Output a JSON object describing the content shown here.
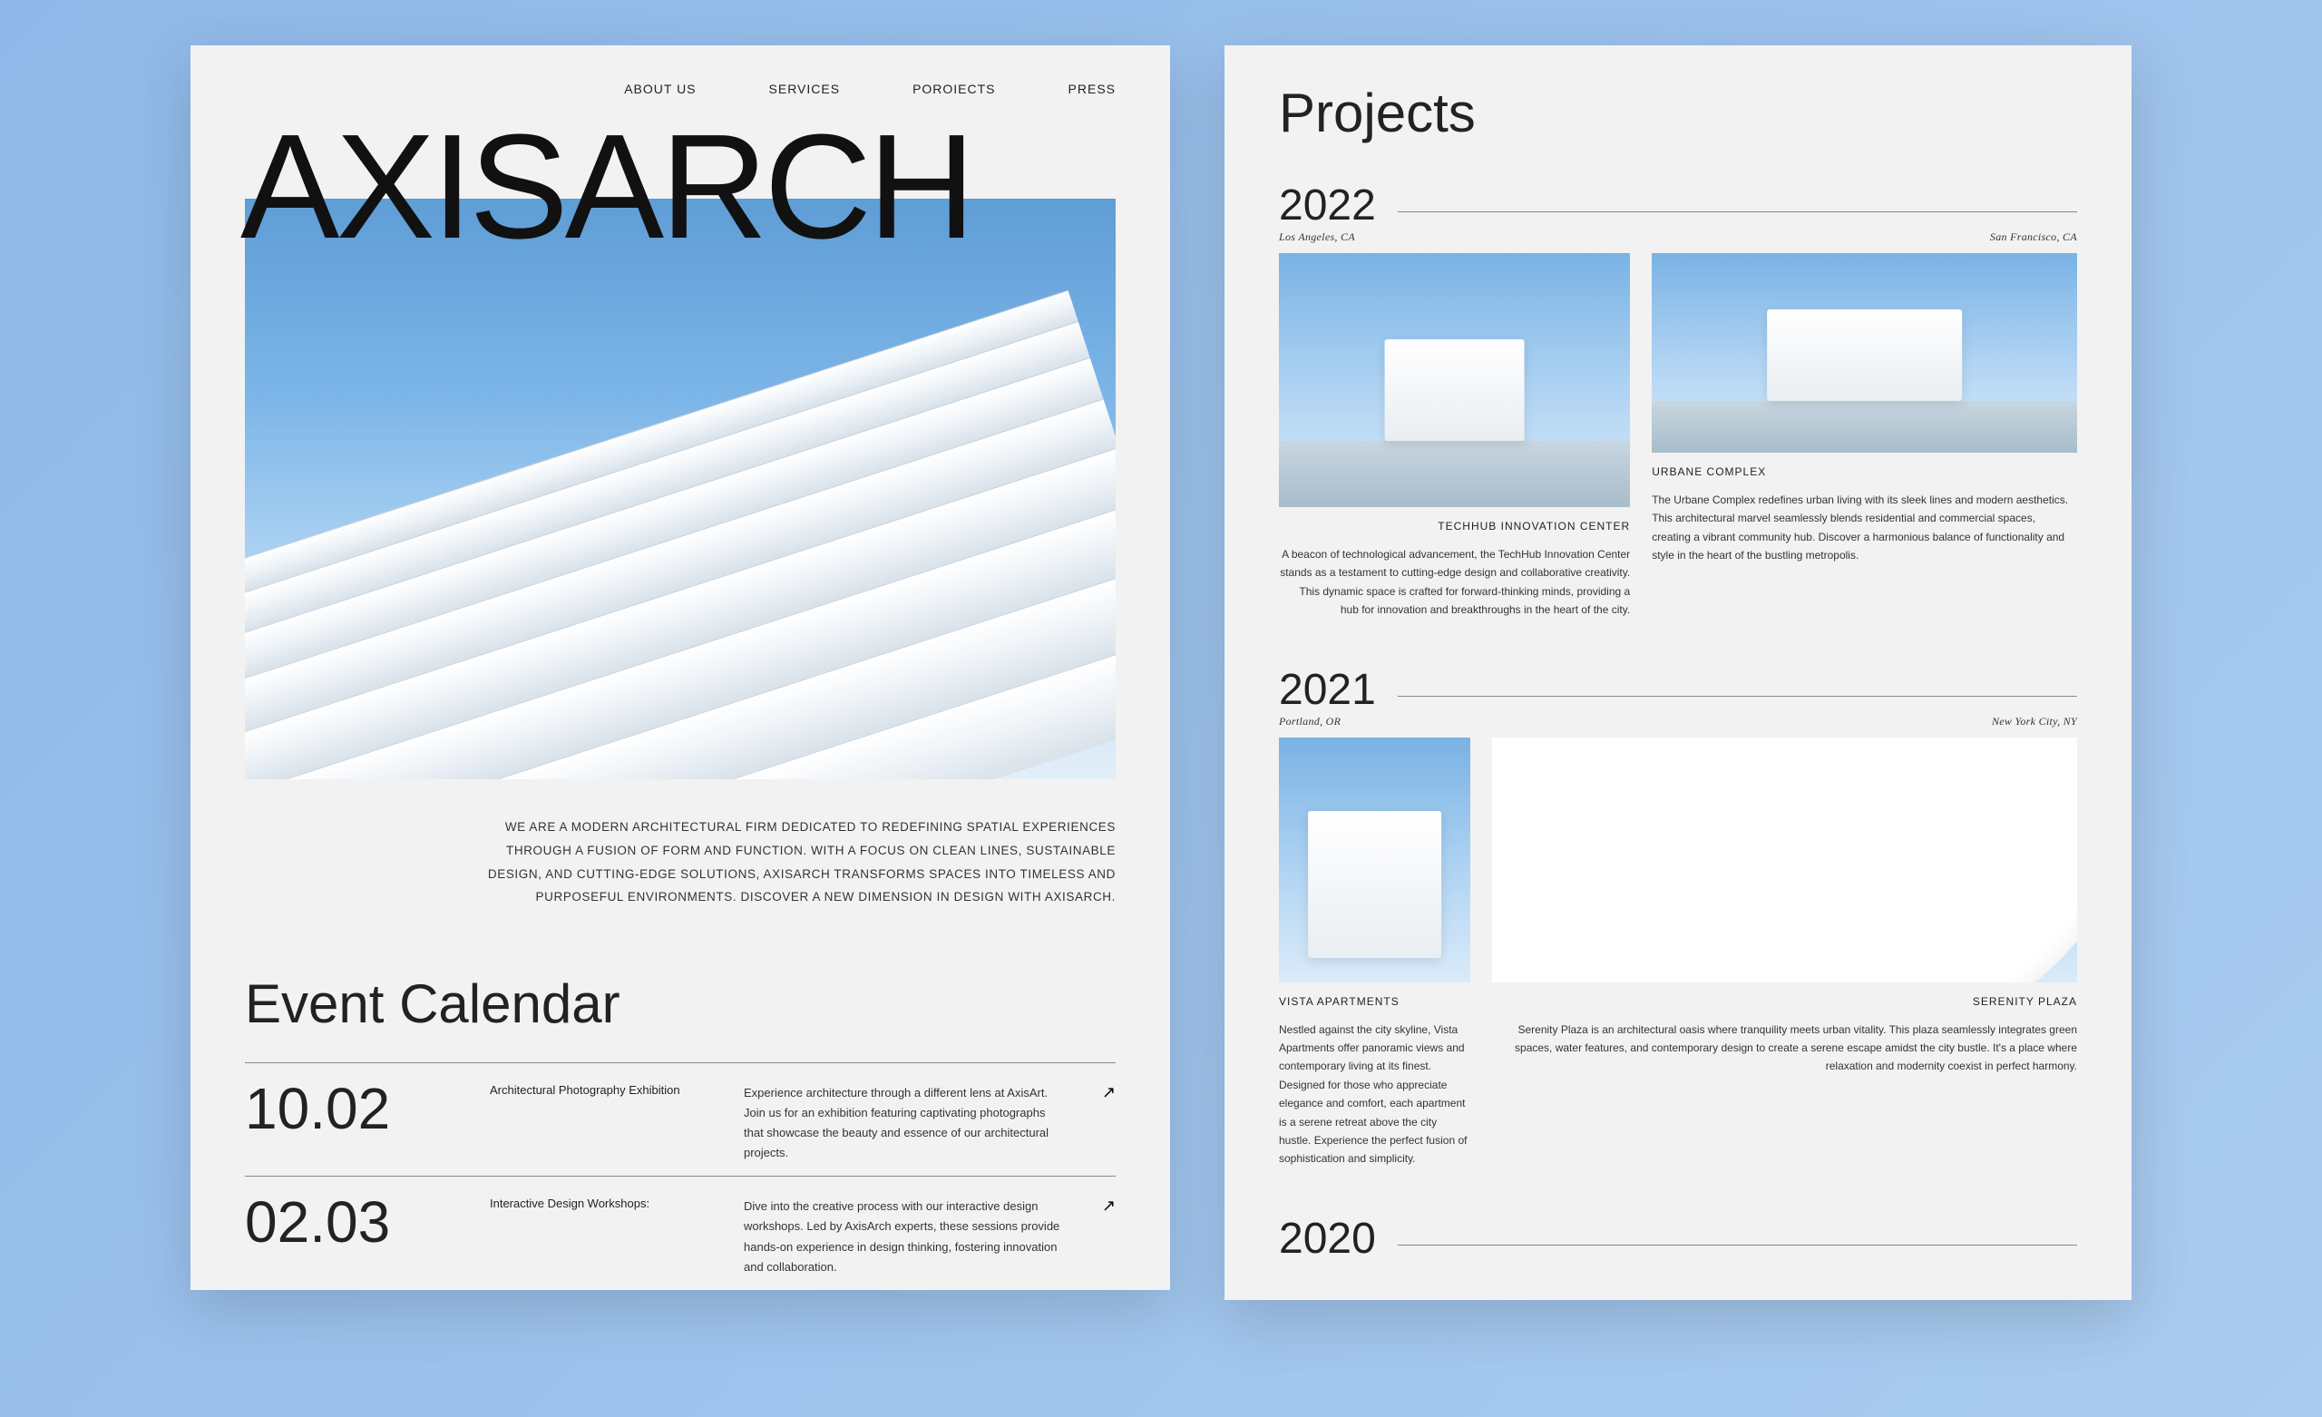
{
  "nav": {
    "items": [
      "ABOUT US",
      "SERVICES",
      "POROIECTS",
      "PRESS"
    ]
  },
  "brand": "AXISARCH",
  "intro": "WE ARE A MODERN ARCHITECTURAL FIRM DEDICATED TO REDEFINING SPATIAL EXPERIENCES THROUGH A FUSION OF FORM AND FUNCTION. WITH A FOCUS ON CLEAN LINES, SUSTAINABLE DESIGN, AND CUTTING-EDGE SOLUTIONS, AXISARCH TRANSFORMS SPACES INTO TIMELESS AND PURPOSEFUL ENVIRONMENTS. DISCOVER A NEW DIMENSION IN DESIGN WITH AXISARCH.",
  "events": {
    "heading": "Event Calendar",
    "items": [
      {
        "date": "10.02",
        "name": "Architectural Photography Exhibition",
        "desc": "Experience architecture through a different lens at AxisArt. Join us for an exhibition featuring captivating photographs that showcase the beauty and essence of our architectural projects.",
        "arrow": "↗"
      },
      {
        "date": "02.03",
        "name": "Interactive Design Workshops:",
        "desc": "Dive into the creative process with our interactive design workshops. Led by AxisArch experts, these sessions provide hands-on experience in design thinking, fostering innovation and collaboration.",
        "arrow": "↗"
      }
    ]
  },
  "projects": {
    "heading": "Projects",
    "years": [
      {
        "year": "2022",
        "cards": [
          {
            "location": "Los Angeles, CA",
            "title": "TECHHUB INNOVATION CENTER",
            "desc": "A beacon of technological advancement, the TechHub Innovation Center stands as a testament to cutting-edge design and collaborative creativity. This dynamic space is crafted for forward-thinking minds, providing a hub for innovation and breakthroughs in the heart of the city.",
            "align": "right"
          },
          {
            "location": "San Francisco, CA",
            "title": "URBANE COMPLEX",
            "desc": "The Urbane Complex redefines urban living with its sleek lines and modern aesthetics. This architectural marvel seamlessly blends residential and commercial spaces, creating a vibrant community hub. Discover a harmonious balance of functionality and style in the heart of the bustling metropolis.",
            "align": "left"
          }
        ]
      },
      {
        "year": "2021",
        "cards": [
          {
            "location": "Portland, OR",
            "title": "VISTA APARTMENTS",
            "desc": "Nestled against the city skyline, Vista Apartments offer panoramic views and contemporary living at its finest. Designed for those who appreciate elegance and comfort, each apartment is a serene retreat above the city hustle. Experience the perfect fusion of sophistication and simplicity.",
            "align": "left"
          },
          {
            "location": "New York City, NY",
            "title": "SERENITY PLAZA",
            "desc": "Serenity Plaza is an architectural oasis where tranquility meets urban vitality. This plaza seamlessly integrates green spaces, water features, and contemporary design to create a serene escape amidst the city bustle. It's a place where relaxation and modernity coexist in perfect harmony.",
            "align": "right"
          }
        ]
      },
      {
        "year": "2020",
        "cards": []
      }
    ]
  }
}
